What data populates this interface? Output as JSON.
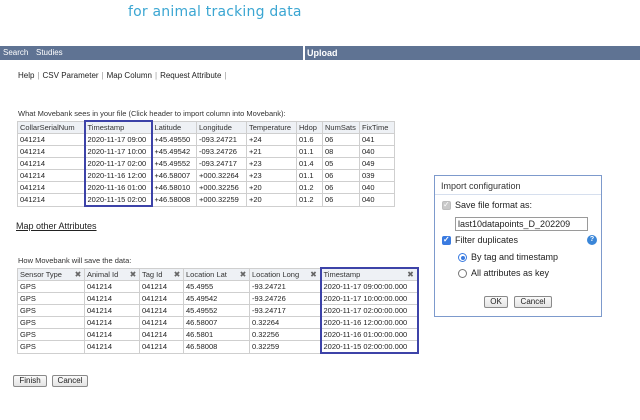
{
  "header": {
    "tagline": "for animal tracking data"
  },
  "nav": {
    "search": "Search",
    "studies": "Studies",
    "upload": "Upload"
  },
  "subnav": [
    "Help",
    "CSV Parameter",
    "Map Column",
    "Request Attribute"
  ],
  "source_section": {
    "label": "What Movebank sees in your file (Click header to import column into Movebank):",
    "columns": [
      "CollarSerialNum",
      "Timestamp",
      "Latitude",
      "Longitude",
      "Temperature",
      "Hdop",
      "NumSats",
      "FixTime"
    ],
    "rows": [
      [
        "041214",
        "2020-11-17 09:00",
        "+45.49550",
        "-093.24721",
        "+24",
        "01.6",
        "06",
        "041"
      ],
      [
        "041214",
        "2020-11-17 10:00",
        "+45.49542",
        "-093.24726",
        "+21",
        "01.1",
        "08",
        "040"
      ],
      [
        "041214",
        "2020-11-17 02:00",
        "+45.49552",
        "-093.24717",
        "+23",
        "01.4",
        "05",
        "049"
      ],
      [
        "041214",
        "2020-11-16 12:00",
        "+46.58007",
        "+000.32264",
        "+23",
        "01.1",
        "06",
        "039"
      ],
      [
        "041214",
        "2020-11-16 01:00",
        "+46.58010",
        "+000.32256",
        "+20",
        "01.2",
        "06",
        "040"
      ],
      [
        "041214",
        "2020-11-15 02:00",
        "+46.58008",
        "+000.32259",
        "+20",
        "01.2",
        "06",
        "040"
      ]
    ]
  },
  "map_other_label": "Map other Attributes",
  "target_section": {
    "label": "How Movebank will save the data:",
    "columns": [
      "Sensor Type",
      "Animal Id",
      "Tag Id",
      "Location Lat",
      "Location Long",
      "Timestamp"
    ],
    "rows": [
      [
        "GPS",
        "041214",
        "041214",
        "45.4955",
        "-93.24721",
        "2020-11-17 09:00:00.000"
      ],
      [
        "GPS",
        "041214",
        "041214",
        "45.49542",
        "-93.24726",
        "2020-11-17 10:00:00.000"
      ],
      [
        "GPS",
        "041214",
        "041214",
        "45.49552",
        "-93.24717",
        "2020-11-17 02:00:00.000"
      ],
      [
        "GPS",
        "041214",
        "041214",
        "46.58007",
        "0.32264",
        "2020-11-16 12:00:00.000"
      ],
      [
        "GPS",
        "041214",
        "041214",
        "46.5801",
        "0.32256",
        "2020-11-16 01:00:00.000"
      ],
      [
        "GPS",
        "041214",
        "041214",
        "46.58008",
        "0.32259",
        "2020-11-15 02:00:00.000"
      ]
    ]
  },
  "import_config": {
    "title": "Import configuration",
    "save_format_label": "Save file format as:",
    "save_format_checked": true,
    "save_format_value": "last10datapoints_D_202209",
    "filter_duplicates_label": "Filter duplicates",
    "filter_duplicates_checked": true,
    "radio_options": [
      "By tag and timestamp",
      "All attributes as key"
    ],
    "radio_selected": 0,
    "ok_label": "OK",
    "cancel_label": "Cancel"
  },
  "footer": {
    "finish_label": "Finish",
    "cancel_label": "Cancel"
  },
  "colors": {
    "nav_bg": "#5f7393",
    "tagline": "#3ba6d2",
    "selected_column": "#3d43a8",
    "accent": "#3a7be0"
  }
}
